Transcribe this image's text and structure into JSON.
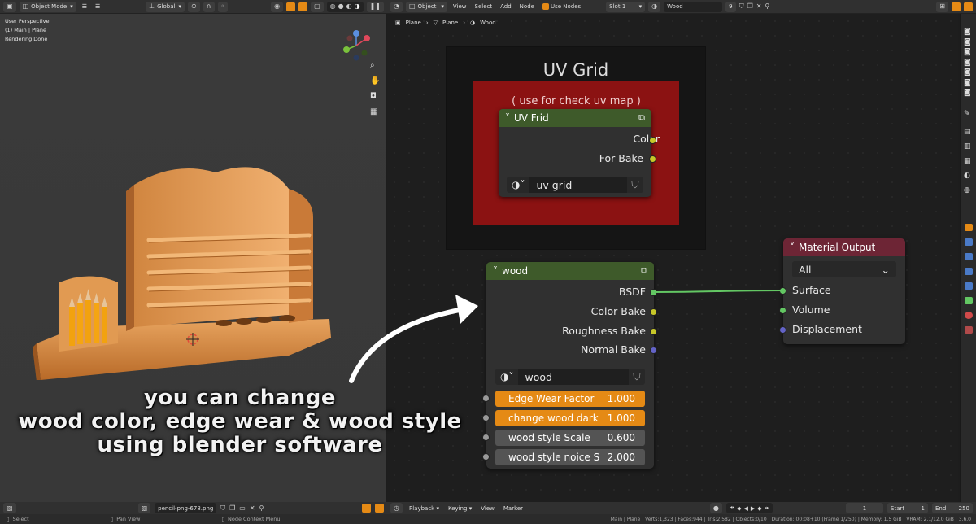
{
  "viewport_header": {
    "mode": "Object Mode",
    "transform": "Global"
  },
  "viewport_info": {
    "line1": "User Perspective",
    "line2": "(1) Main | Plane",
    "line3": "Rendering Done"
  },
  "node_header": {
    "type": "Object",
    "menus": [
      "View",
      "Select",
      "Add",
      "Node"
    ],
    "use_nodes": "Use Nodes",
    "slot": "Slot 1",
    "material": "Wood",
    "users": "9"
  },
  "breadcrumb": [
    "Plane",
    "Plane",
    "Wood"
  ],
  "frame_uvgrid": {
    "title": "UV Grid",
    "subtitle": "( use for check uv map )"
  },
  "node_uvfrid": {
    "title": "UV Frid",
    "outputs": [
      "Color",
      "For Bake"
    ],
    "image_name": "uv grid"
  },
  "node_wood": {
    "title": "wood",
    "outputs": [
      "BSDF",
      "Color Bake",
      "Roughness Bake",
      "Normal Bake"
    ],
    "image_name": "wood",
    "inputs": [
      {
        "label": "Edge Wear Factor",
        "value": "1.000",
        "fill": 1.0
      },
      {
        "label": "change wood dark",
        "value": "1.000",
        "fill": 1.0
      },
      {
        "label": "wood style Scale",
        "value": "0.600",
        "fill": 0
      },
      {
        "label": "wood style noice S",
        "value": "2.000",
        "fill": 0
      }
    ]
  },
  "node_output": {
    "title": "Material Output",
    "target": "All",
    "inputs": [
      "Surface",
      "Volume",
      "Displacement"
    ]
  },
  "caption": {
    "line1": "you can change",
    "line2": "wood color, edge wear & wood style",
    "line3": "using blender software"
  },
  "bottom_left": {
    "image_name": "pencil-png-678.png"
  },
  "timeline": {
    "menus": [
      "Playback",
      "Keying",
      "View",
      "Marker"
    ],
    "current_frame": "1",
    "start_label": "Start",
    "start": "1",
    "end_label": "End",
    "end": "250"
  },
  "status_bar": {
    "select": "Select",
    "pan": "Pan View",
    "context": "Node Context Menu",
    "stats": "Main | Plane | Verts:1,323 | Faces:944 | Tris:2,582 | Objects:0/10 | Duration: 00:08+10 (Frame 1/250) | Memory: 1.5 GiB | VRAM: 2.1/12.0 GiB | 3.6.0"
  },
  "colors": {
    "accent": "#e58a15",
    "socket_yellow": "#c7c729",
    "socket_green": "#63c763",
    "socket_purple": "#6363c7",
    "link_green": "#63c763",
    "frame_red": "#8b1212",
    "wood_header": "#3e5a2a",
    "output_header": "#6d2535"
  }
}
